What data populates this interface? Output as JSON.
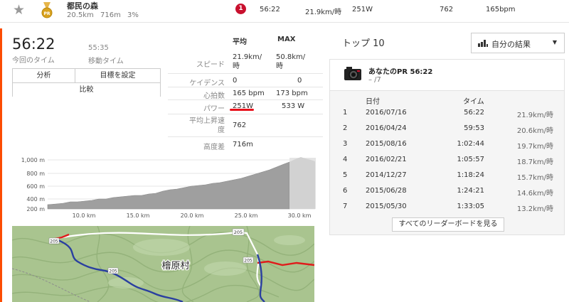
{
  "segment": {
    "name": "都民の森",
    "meta": "20.5km 716m 3%",
    "rank": "1",
    "time": "56:22",
    "speed": "21.9km/時",
    "power": "251W",
    "elev_gain": "762",
    "heartrate": "165bpm"
  },
  "summary": {
    "elapsed_time": "56:22",
    "elapsed_label": "今回のタイム",
    "moving_time": "55:35",
    "moving_label": "移動タイム"
  },
  "buttons": {
    "analyze": "分析",
    "set_goal": "目標を設定",
    "compare": "比較"
  },
  "stats": {
    "col_avg": "平均",
    "col_max": "MAX",
    "rows": [
      {
        "label": "スピード",
        "avg": "21.9km/\n時",
        "max": "50.8km/\n時"
      },
      {
        "label": "ケイデンス",
        "avg": "0",
        "max": "0"
      },
      {
        "label": "心拍数",
        "avg": "165 bpm",
        "max": "173 bpm"
      },
      {
        "label": "パワー",
        "avg": "251W",
        "max": "533 W"
      },
      {
        "label": "平均上昇速\n度",
        "avg": "762",
        "max": ""
      },
      {
        "label": "高度差",
        "avg": "716m",
        "max": ""
      }
    ]
  },
  "elevation": {
    "y_ticks": [
      "1,000 m",
      "800 m",
      "600 m",
      "400 m",
      "200 m"
    ],
    "x_ticks": [
      "10.0 km",
      "15.0 km",
      "20.0 km",
      "25.0 km",
      "30.0 km"
    ]
  },
  "map": {
    "place_label": "檜原村",
    "road_signs": [
      "205",
      "205",
      "205",
      "205"
    ]
  },
  "leaderboard": {
    "title": "トップ 10",
    "filter_label": "自分の結果",
    "pr_title": "あなたのPR 56:22",
    "pr_sub": "– /7",
    "col_date": "日付",
    "col_time": "タイム",
    "rows": [
      {
        "rank": "1",
        "date": "2016/07/16",
        "time": "56:22",
        "speed": "21.9km/時"
      },
      {
        "rank": "2",
        "date": "2016/04/24",
        "time": "59:53",
        "speed": "20.6km/時"
      },
      {
        "rank": "3",
        "date": "2015/08/16",
        "time": "1:02:44",
        "speed": "19.7km/時"
      },
      {
        "rank": "4",
        "date": "2016/02/21",
        "time": "1:05:57",
        "speed": "18.7km/時"
      },
      {
        "rank": "5",
        "date": "2014/12/27",
        "time": "1:18:24",
        "speed": "15.7km/時"
      },
      {
        "rank": "6",
        "date": "2015/06/28",
        "time": "1:24:21",
        "speed": "14.6km/時"
      },
      {
        "rank": "7",
        "date": "2015/05/30",
        "time": "1:33:05",
        "speed": "13.2km/時"
      }
    ],
    "more_label": "すべてのリーダーボードを見る"
  },
  "colors": {
    "accent": "#fc4c02",
    "badge_red": "#c8102e",
    "route_blue": "#2a3fa0",
    "route_red": "#e01b1b"
  }
}
